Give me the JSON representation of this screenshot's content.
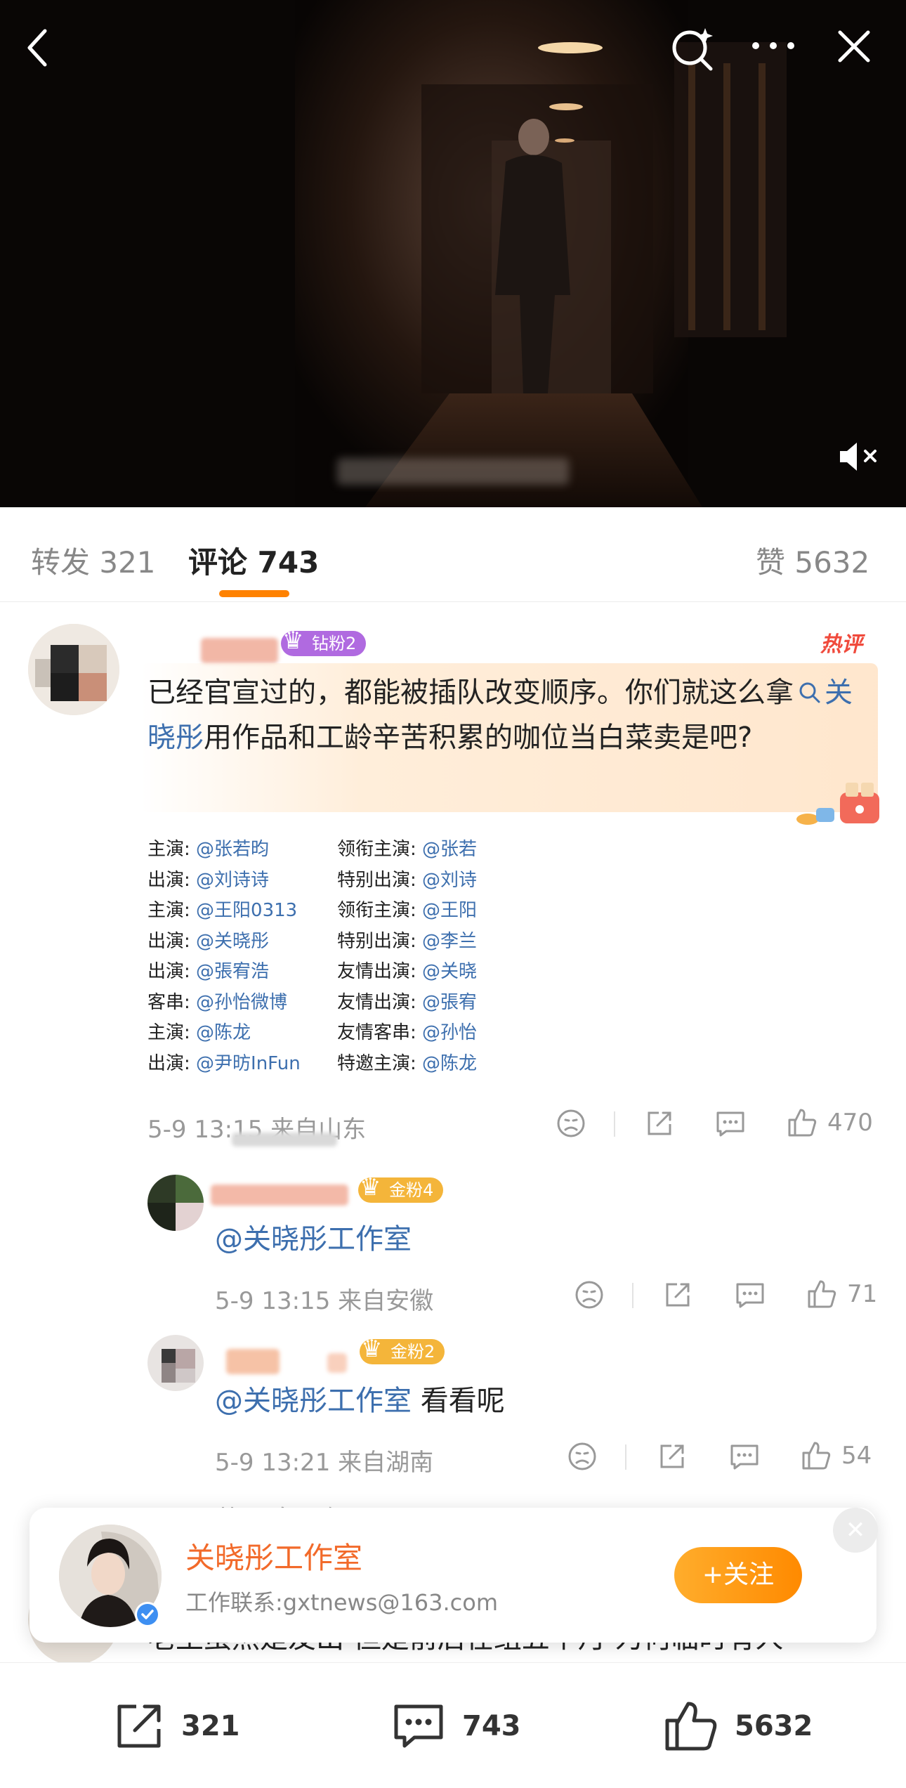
{
  "video": {
    "icons": {
      "back": "chevron-left-icon",
      "search": "search-sparkle-icon",
      "more": "more-dots-icon",
      "close": "close-icon",
      "mute": "speaker-muted-icon"
    }
  },
  "tabs": {
    "repost": "转发 321",
    "comments": "评论 743",
    "likes": "赞 5632",
    "accent": "#ff8200"
  },
  "comment1": {
    "badge": "钻粉2",
    "hot": "热评",
    "text_before": "已经官宣过的，都能被插队改变顺序。你们就这么拿",
    "topic": "关晓彤",
    "text_after": "用作品和工龄辛苦积累的咖位当白菜卖是吧?",
    "cast_left": [
      {
        "role": "主演:",
        "name": "@张若昀"
      },
      {
        "role": "出演:",
        "name": "@刘诗诗"
      },
      {
        "role": "主演:",
        "name": "@王阳0313"
      },
      {
        "role": "出演:",
        "name": "@关晓彤"
      },
      {
        "role": "出演:",
        "name": "@張宥浩"
      },
      {
        "role": "客串:",
        "name": "@孙怡微博"
      },
      {
        "role": "主演:",
        "name": "@陈龙"
      },
      {
        "role": "出演:",
        "name": "@尹昉InFun"
      }
    ],
    "cast_right": [
      {
        "role": "领衔主演:",
        "name": "@张若"
      },
      {
        "role": "特别出演:",
        "name": "@刘诗"
      },
      {
        "role": "领衔主演:",
        "name": "@王阳"
      },
      {
        "role": "特别出演:",
        "name": "@李兰"
      },
      {
        "role": "友情出演:",
        "name": "@关晓"
      },
      {
        "role": "友情出演:",
        "name": "@張宥"
      },
      {
        "role": "友情客串:",
        "name": "@孙怡"
      },
      {
        "role": "特邀主演:",
        "name": "@陈龙"
      }
    ],
    "meta": "5-9 13:15  来自山东",
    "likes": "470"
  },
  "reply1": {
    "badge": "金粉4",
    "text": "@关晓彤工作室",
    "meta": "5-9 13:15  来自安徽",
    "likes": "71"
  },
  "reply2": {
    "badge": "金粉2",
    "mention": "@关晓彤工作室",
    "text": " 看看呢",
    "meta": "5-9 13:21  来自湖南",
    "likes": "54"
  },
  "more_replies": "共49条回复 >",
  "comment2_partial": "老王虽然是友出 但是前后在组五个月 为何临时有人",
  "follow_card": {
    "name": "关晓彤工作室",
    "contact": "工作联系:gxtnews@163.com",
    "button": "+关注",
    "verified_color": "#3d8ff2"
  },
  "bottom_bar": {
    "repost": "321",
    "comment": "743",
    "like": "5632"
  }
}
